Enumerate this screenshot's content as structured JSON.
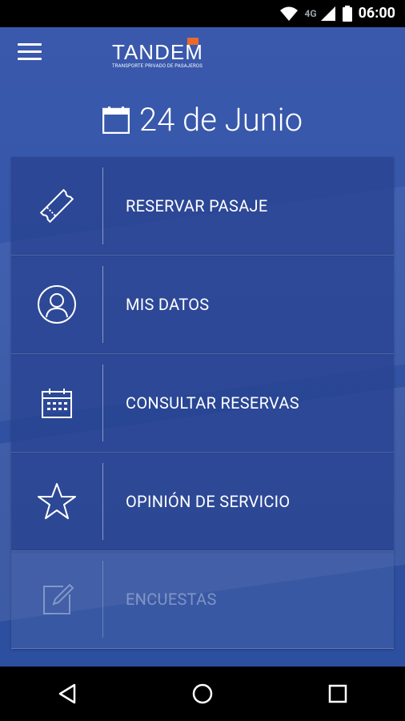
{
  "status": {
    "network": "4G",
    "time": "06:00"
  },
  "header": {
    "brand": "TANDE",
    "brand_last": "M",
    "tagline": "TRANSPORTE PRIVADO DE PASAJEROS"
  },
  "date_label": "24 de Junio",
  "menu": [
    {
      "label": "RESERVAR PASAJE",
      "icon": "ticket-icon",
      "enabled": true
    },
    {
      "label": "MIS DATOS",
      "icon": "user-icon",
      "enabled": true
    },
    {
      "label": "CONSULTAR RESERVAS",
      "icon": "calendar-icon",
      "enabled": true
    },
    {
      "label": "OPINIÓN DE SERVICIO",
      "icon": "star-icon",
      "enabled": true
    },
    {
      "label": "ENCUESTAS",
      "icon": "edit-icon",
      "enabled": false
    }
  ],
  "colors": {
    "primary": "#3556a9",
    "accent": "#e86a2c"
  }
}
